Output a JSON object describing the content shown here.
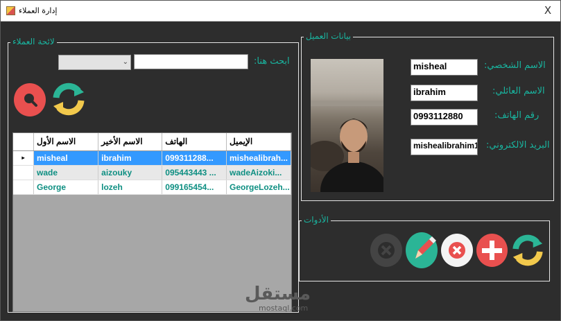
{
  "window": {
    "title": "إدارة العملاء",
    "close_glyph": "X"
  },
  "customers_list": {
    "legend": "لائحة العملاء",
    "search_label": "ابحث هنا:",
    "search_value": "",
    "filter_value": "",
    "grid": {
      "columns": [
        "الاسم الأول",
        "الاسم الأخير",
        "الهاتف",
        "الإيميل"
      ],
      "rows": [
        {
          "first": "misheal",
          "last": "ibrahim",
          "phone": "099311288...",
          "email": "mishealibrah...",
          "selected": true,
          "marker": "▸"
        },
        {
          "first": "wade",
          "last": "aizouky",
          "phone": "095443443 ...",
          "email": "wadeAizoki...",
          "selected": false,
          "marker": ""
        },
        {
          "first": "George",
          "last": "lozeh",
          "phone": "099165454...",
          "email": "GeorgeLozeh...",
          "selected": false,
          "marker": ""
        }
      ]
    }
  },
  "customer_details": {
    "legend": "بيانات العميل",
    "first_name_label": "الاسم الشخصي:",
    "first_name_value": "misheal",
    "last_name_label": "الاسم العائلي:",
    "last_name_value": "ibrahim",
    "phone_label": "رقم الهاتف:",
    "phone_value": "0993112880",
    "email_label": "البريد الالكتروني:",
    "email_value": "mishealibrahim1"
  },
  "tools": {
    "legend": "الأدوات"
  },
  "watermark": {
    "text": "مستقل",
    "sub": "mostaql.com"
  },
  "colors": {
    "accent": "#19b5a0",
    "red": "#e9504f",
    "green": "#2bb596",
    "yellow": "#f2c94c",
    "disabled": "#444444"
  }
}
